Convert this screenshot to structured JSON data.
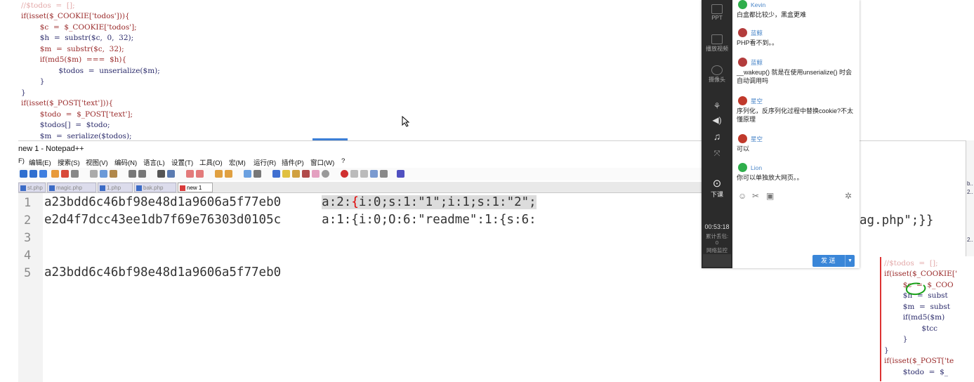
{
  "background_code": {
    "lines": [
      "//$todos  =  [];",
      "if(isset($_COOKIE['todos'])){",
      "        $c  =  $_COOKIE['todos'];",
      "        $h  =  substr($c,  0,  32);",
      "        $m  =  substr($c,  32);",
      "        if(md5($m)  ===  $h){",
      "                $todos  =  unserialize($m);",
      "        }",
      "}",
      "if(isset($_POST['text'])){",
      "        $todo  =  $_POST['text'];",
      "        $todos[]  =  $todo;",
      "        $m  =  serialize($todos);"
    ]
  },
  "notepad": {
    "title": "new 1 - Notepad++",
    "window_controls": {
      "minimize": "–",
      "maximize": "☐",
      "close": "✕"
    },
    "inner_close": "x",
    "menu": [
      "F)",
      "编辑(E)",
      "搜索(S)",
      "视图(V)",
      "编码(N)",
      "语言(L)",
      "设置(T)",
      "工具(O)",
      "宏(M)",
      "运行(R)",
      "插件(P)",
      "窗口(W)",
      "?"
    ],
    "tabs": [
      {
        "label": "st.php",
        "active": false
      },
      {
        "label": "magic.php",
        "active": false
      },
      {
        "label": "1.php",
        "active": false
      },
      {
        "label": "bak.php",
        "active": false
      },
      {
        "label": "new 1",
        "active": true
      }
    ],
    "line_numbers": [
      "1",
      "2",
      "3",
      "4",
      "5"
    ],
    "lines": {
      "l1_hash": "a23bdd6c46bf98e48d1a9606a5f77eb0",
      "l1_ser_a": "a:2:",
      "l1_brace": "{",
      "l1_ser_b": "i:0;s:1:\"1\";i:1;s:1:\"2\";",
      "l2_hash": "e2d4f7dcc43ee1db7f69e76303d0105c",
      "l2_ser": "a:1:{i:0;O:6:\"readme\":1:{s:6:",
      "l2_tail": "ag.php\";}}",
      "l5_hash": "a23bdd6c46bf98e48d1a9606a5f77eb0"
    }
  },
  "chat": {
    "rail": [
      {
        "icon": "ppt-icon",
        "label": "PPT"
      },
      {
        "icon": "video-icon",
        "label": "播放视频"
      },
      {
        "icon": "camera-icon",
        "label": "摄像头"
      }
    ],
    "rail_leave": "下课",
    "timer": "00:53:18",
    "stat_label": "累计丢包:",
    "stat_value": "0",
    "net_label": "网络监控",
    "messages": [
      {
        "user": "Kevin",
        "text": "白盒都比较少，黑盒更难",
        "avatar_color": "#2fae4b"
      },
      {
        "user": "蓝鲸",
        "text": "PHP看不到。。",
        "avatar_color": "#b33c3c"
      },
      {
        "user": "蓝鲸",
        "text": "__wakeup() 就是在使用unserialize() 时会自动调用吗",
        "avatar_color": "#b33c3c"
      },
      {
        "user": "星空",
        "text": "序列化，反序列化过程中替换cookie?不太懂原理",
        "avatar_color": "#c0392b"
      },
      {
        "user": "星空",
        "text": "可以",
        "avatar_color": "#c0392b"
      },
      {
        "user": "Lion",
        "text": "你可以单独放大网页。。",
        "avatar_color": "#2fae4b"
      }
    ],
    "send_label": "发 送"
  },
  "inset_code": {
    "lines": [
      "//$todos  =  [];",
      "if(isset($_COOKIE['",
      "        $c  =  $_COO",
      "        $h  =  subst",
      "        $m  =  subst",
      "        if(md5($m)",
      "                $tcc",
      "        }",
      "}",
      "if(isset($_POST['te",
      "        $todo  =  $_"
    ]
  },
  "right_edge": [
    "b..",
    "2..",
    "2.."
  ]
}
